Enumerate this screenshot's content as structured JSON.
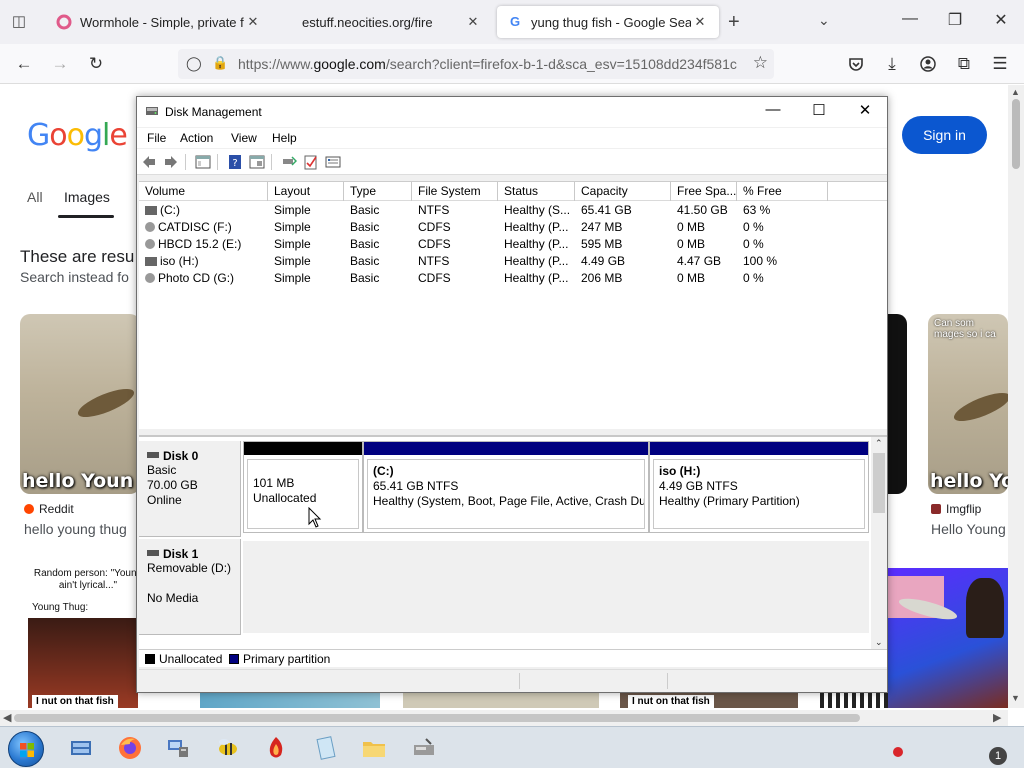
{
  "browser": {
    "tabs": [
      {
        "title": "Wormhole - Simple, private file",
        "icon": "wormhole-icon",
        "active": false
      },
      {
        "title": "estuff.neocities.org/fire",
        "icon": "",
        "active": false
      },
      {
        "title": "yung thug fish - Google Search",
        "icon": "google-icon",
        "active": true
      }
    ],
    "url_prefix": "https://www.",
    "url_domain": "google.com",
    "url_rest": "/search?client=firefox-b-1-d&sca_esv=15108dd234f581c"
  },
  "google": {
    "logo": "Google",
    "sign_in": "Sign in",
    "tabs": [
      "All",
      "Images"
    ],
    "notice_main": "These are resu",
    "notice_sub": "Search instead fo",
    "results": [
      {
        "caption": "hello Youn",
        "source": "Reddit",
        "title": "hello young thug"
      },
      {
        "caption": "hello Yo",
        "source": "Imgflip",
        "title": "Hello Young",
        "top_text": "Can som\nmages so i ca"
      },
      {
        "meme_line1": "Random person: \"Young",
        "meme_line2": "ain't lyrical...\"",
        "meme_line3": "Young Thug:",
        "meme_caption": "I nut on that fish"
      },
      {
        "meme_caption": "I nut on that fish"
      }
    ]
  },
  "disk_management": {
    "title": "Disk Management",
    "menu": [
      "File",
      "Action",
      "View",
      "Help"
    ],
    "columns": [
      "Volume",
      "Layout",
      "Type",
      "File System",
      "Status",
      "Capacity",
      "Free Spa...",
      "% Free"
    ],
    "volumes": [
      {
        "volume": "(C:)",
        "layout": "Simple",
        "type": "Basic",
        "fs": "NTFS",
        "status": "Healthy (S...",
        "capacity": "65.41 GB",
        "free": "41.50 GB",
        "pct": "63 %",
        "icon": "hdd"
      },
      {
        "volume": "CATDISC (F:)",
        "layout": "Simple",
        "type": "Basic",
        "fs": "CDFS",
        "status": "Healthy (P...",
        "capacity": "247 MB",
        "free": "0 MB",
        "pct": "0 %",
        "icon": "cd"
      },
      {
        "volume": "HBCD 15.2 (E:)",
        "layout": "Simple",
        "type": "Basic",
        "fs": "CDFS",
        "status": "Healthy (P...",
        "capacity": "595 MB",
        "free": "0 MB",
        "pct": "0 %",
        "icon": "cd"
      },
      {
        "volume": "iso (H:)",
        "layout": "Simple",
        "type": "Basic",
        "fs": "NTFS",
        "status": "Healthy (P...",
        "capacity": "4.49 GB",
        "free": "4.47 GB",
        "pct": "100 %",
        "icon": "hdd"
      },
      {
        "volume": "Photo CD (G:)",
        "layout": "Simple",
        "type": "Basic",
        "fs": "CDFS",
        "status": "Healthy (P...",
        "capacity": "206 MB",
        "free": "0 MB",
        "pct": "0 %",
        "icon": "cd"
      }
    ],
    "disks": [
      {
        "name": "Disk 0",
        "kind": "Basic",
        "size": "70.00 GB",
        "state": "Online",
        "partitions": [
          {
            "name": "",
            "size": "101 MB",
            "status": "Unallocated",
            "color": "#000000"
          },
          {
            "name": "(C:)",
            "size": "65.41 GB NTFS",
            "status": "Healthy (System, Boot, Page File, Active, Crash Dum",
            "color": "#00007f"
          },
          {
            "name": "iso  (H:)",
            "size": "4.49 GB NTFS",
            "status": "Healthy (Primary Partition)",
            "color": "#00007f"
          }
        ]
      },
      {
        "name": "Disk 1",
        "kind": "Removable (D:)",
        "state": "No Media"
      }
    ],
    "legend": [
      {
        "label": "Unallocated",
        "color": "#000000"
      },
      {
        "label": "Primary partition",
        "color": "#00007f"
      }
    ]
  },
  "taskbar": {
    "tray_badge": "1"
  }
}
